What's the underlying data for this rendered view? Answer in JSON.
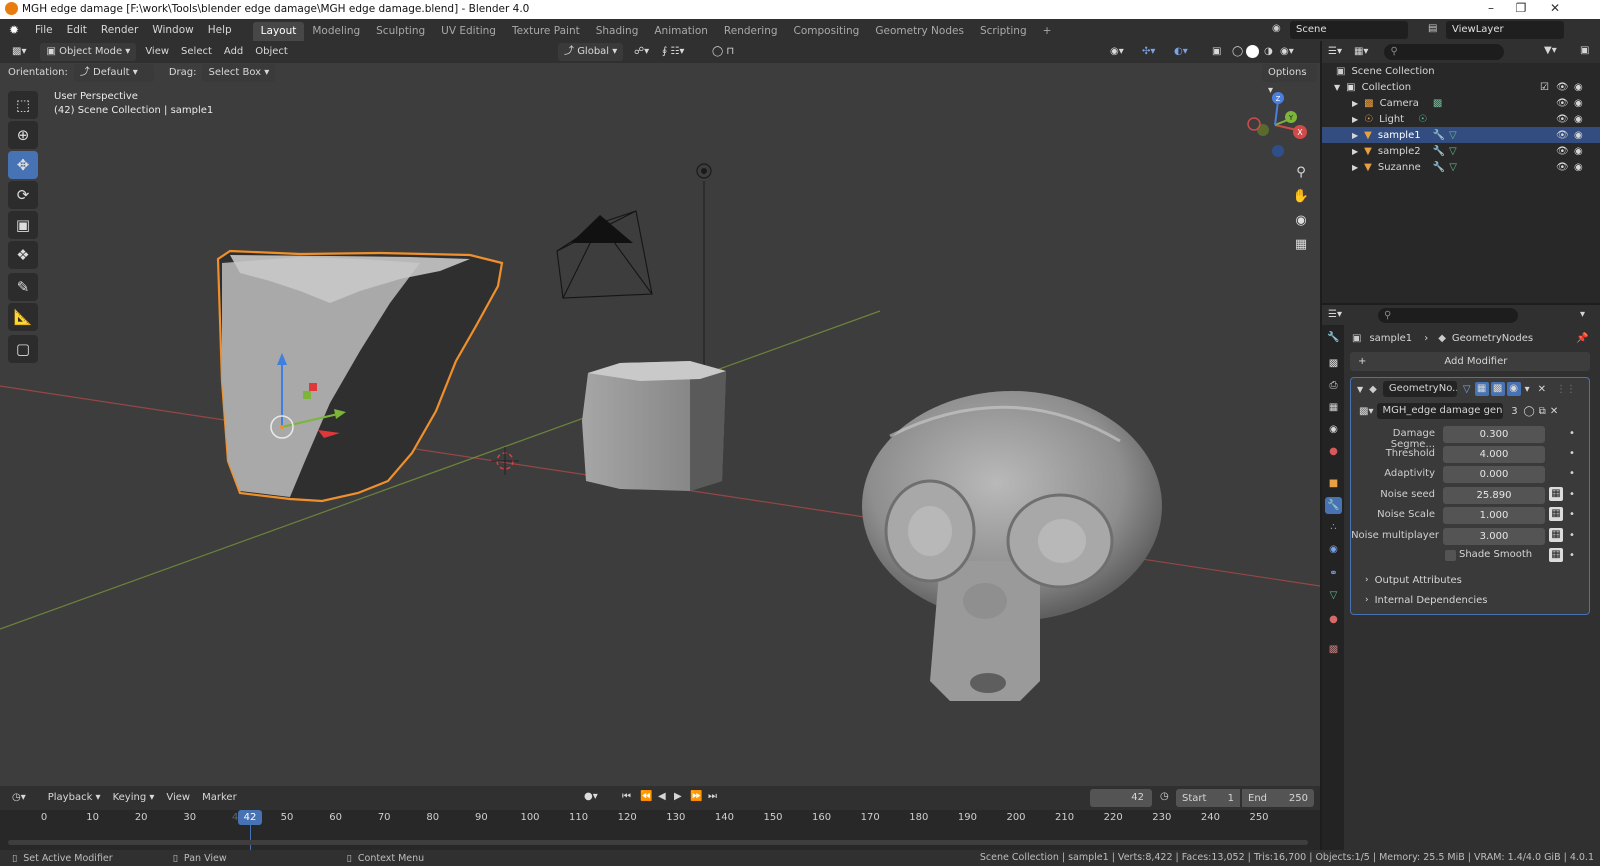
{
  "window": {
    "title": "MGH edge damage [F:\\work\\Tools\\blender edge damage\\MGH edge damage.blend] - Blender 4.0"
  },
  "menu": {
    "items": [
      "File",
      "Edit",
      "Render",
      "Window",
      "Help"
    ],
    "workspaces": [
      "Layout",
      "Modeling",
      "Sculpting",
      "UV Editing",
      "Texture Paint",
      "Shading",
      "Animation",
      "Rendering",
      "Compositing",
      "Geometry Nodes",
      "Scripting"
    ],
    "active_workspace": "Layout",
    "scene": "Scene",
    "view_layer": "ViewLayer"
  },
  "viewport": {
    "mode": "Object Mode",
    "menus": [
      "View",
      "Select",
      "Add",
      "Object"
    ],
    "transform_orientation": "Global",
    "orientation_label": "Orientation:",
    "orientation_value": "Default",
    "drag_label": "Drag:",
    "drag_value": "Select Box",
    "options_label": "Options",
    "overlay_title": "User Perspective",
    "overlay_subtitle": "(42) Scene Collection | sample1",
    "gizmo_axes": [
      "X",
      "Y",
      "Z"
    ]
  },
  "timeline": {
    "menus": [
      "Playback",
      "Keying",
      "View",
      "Marker"
    ],
    "current_frame": "42",
    "start_label": "Start",
    "start_value": "1",
    "end_label": "End",
    "end_value": "250",
    "ticks": [
      "0",
      "10",
      "20",
      "30",
      "40",
      "50",
      "60",
      "70",
      "80",
      "90",
      "100",
      "110",
      "120",
      "130",
      "140",
      "150",
      "160",
      "170",
      "180",
      "190",
      "200",
      "210",
      "220",
      "230",
      "240",
      "250"
    ]
  },
  "outliner": {
    "root": "Scene Collection",
    "collection": "Collection",
    "items": [
      {
        "name": "Camera"
      },
      {
        "name": "Light"
      },
      {
        "name": "sample1"
      },
      {
        "name": "sample2"
      },
      {
        "name": "Suzanne"
      }
    ]
  },
  "properties": {
    "breadcrumb_object": "sample1",
    "breadcrumb_modifier": "GeometryNodes",
    "add_modifier_label": "Add Modifier",
    "modifier_name": "GeometryNo...",
    "node_group": "MGH_edge damage gener...",
    "node_group_users": "3",
    "fields": [
      {
        "label": "Damage Segme...",
        "value": "0.300"
      },
      {
        "label": "Threshold",
        "value": "4.000"
      },
      {
        "label": "Adaptivity",
        "value": "0.000"
      },
      {
        "label": "Noise seed",
        "value": "25.890"
      },
      {
        "label": "Noise Scale",
        "value": "1.000"
      },
      {
        "label": "Noise multiplayer",
        "value": "3.000"
      }
    ],
    "shade_smooth_label": "Shade Smooth",
    "output_attributes_label": "Output Attributes",
    "internal_dependencies_label": "Internal Dependencies"
  },
  "statusbar": {
    "hints": [
      "Set Active Modifier",
      "Pan View",
      "Context Menu"
    ],
    "stats": "Scene Collection | sample1 | Verts:8,422 | Faces:13,052 | Tris:16,700 | Objects:1/5 | Memory: 25.5 MiB | VRAM: 1.4/4.0 GiB | 4.0.1"
  },
  "colors": {
    "accent": "#4772b3",
    "selection_outline": "#f0902c",
    "viewport_bg": "#3d3d3d",
    "x_axis": "#c94a4a",
    "y_axis": "#7ca23a"
  }
}
